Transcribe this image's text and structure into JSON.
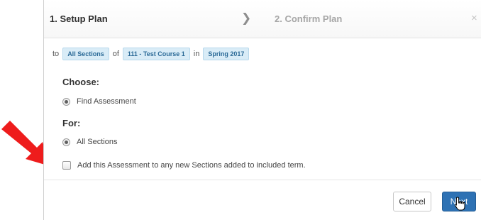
{
  "wizard": {
    "step1_label": "1. Setup Plan",
    "step2_label": "2. Confirm Plan",
    "chevron_glyph": "❯",
    "close_glyph": "×"
  },
  "scope": {
    "prefix_to": "to",
    "sections": "All Sections",
    "word_of": "of",
    "course": "111 - Test Course 1",
    "word_in": "in",
    "term": "Spring 2017"
  },
  "choose": {
    "title": "Choose:",
    "option_label": "Find Assessment",
    "selected": true
  },
  "for_section": {
    "title": "For:",
    "option_label": "All Sections",
    "selected": true
  },
  "add_to_new_sections": {
    "label": "Add this Assessment to any new Sections added to included term.",
    "checked": false
  },
  "footer": {
    "cancel_label": "Cancel",
    "next_label": "Next"
  },
  "colors": {
    "primary_button": "#2e72b4",
    "chip_background": "#d9ecf7",
    "chip_text": "#2b6a97",
    "annotation_arrow": "#ee1c1c"
  },
  "icons": {
    "cursor": "hand-pointer-icon",
    "annotation": "red-arrow-icon"
  }
}
